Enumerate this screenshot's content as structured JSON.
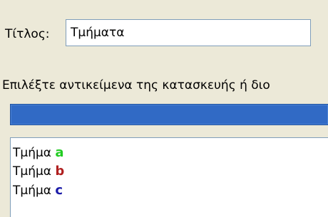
{
  "title_field": {
    "label": "Τίτλος:",
    "value": "Τμήματα"
  },
  "instruction_text": "Επιλέξτε αντικείμενα της κατασκευής ή διο",
  "selection_bar": {
    "color": "#316ac5"
  },
  "list": {
    "items": [
      {
        "prefix": "Τμήμα",
        "letter": "a",
        "letter_color": "#22cc22"
      },
      {
        "prefix": "Τμήμα",
        "letter": "b",
        "letter_color": "#b02020"
      },
      {
        "prefix": "Τμήμα",
        "letter": "c",
        "letter_color": "#1a1aa8"
      }
    ]
  }
}
